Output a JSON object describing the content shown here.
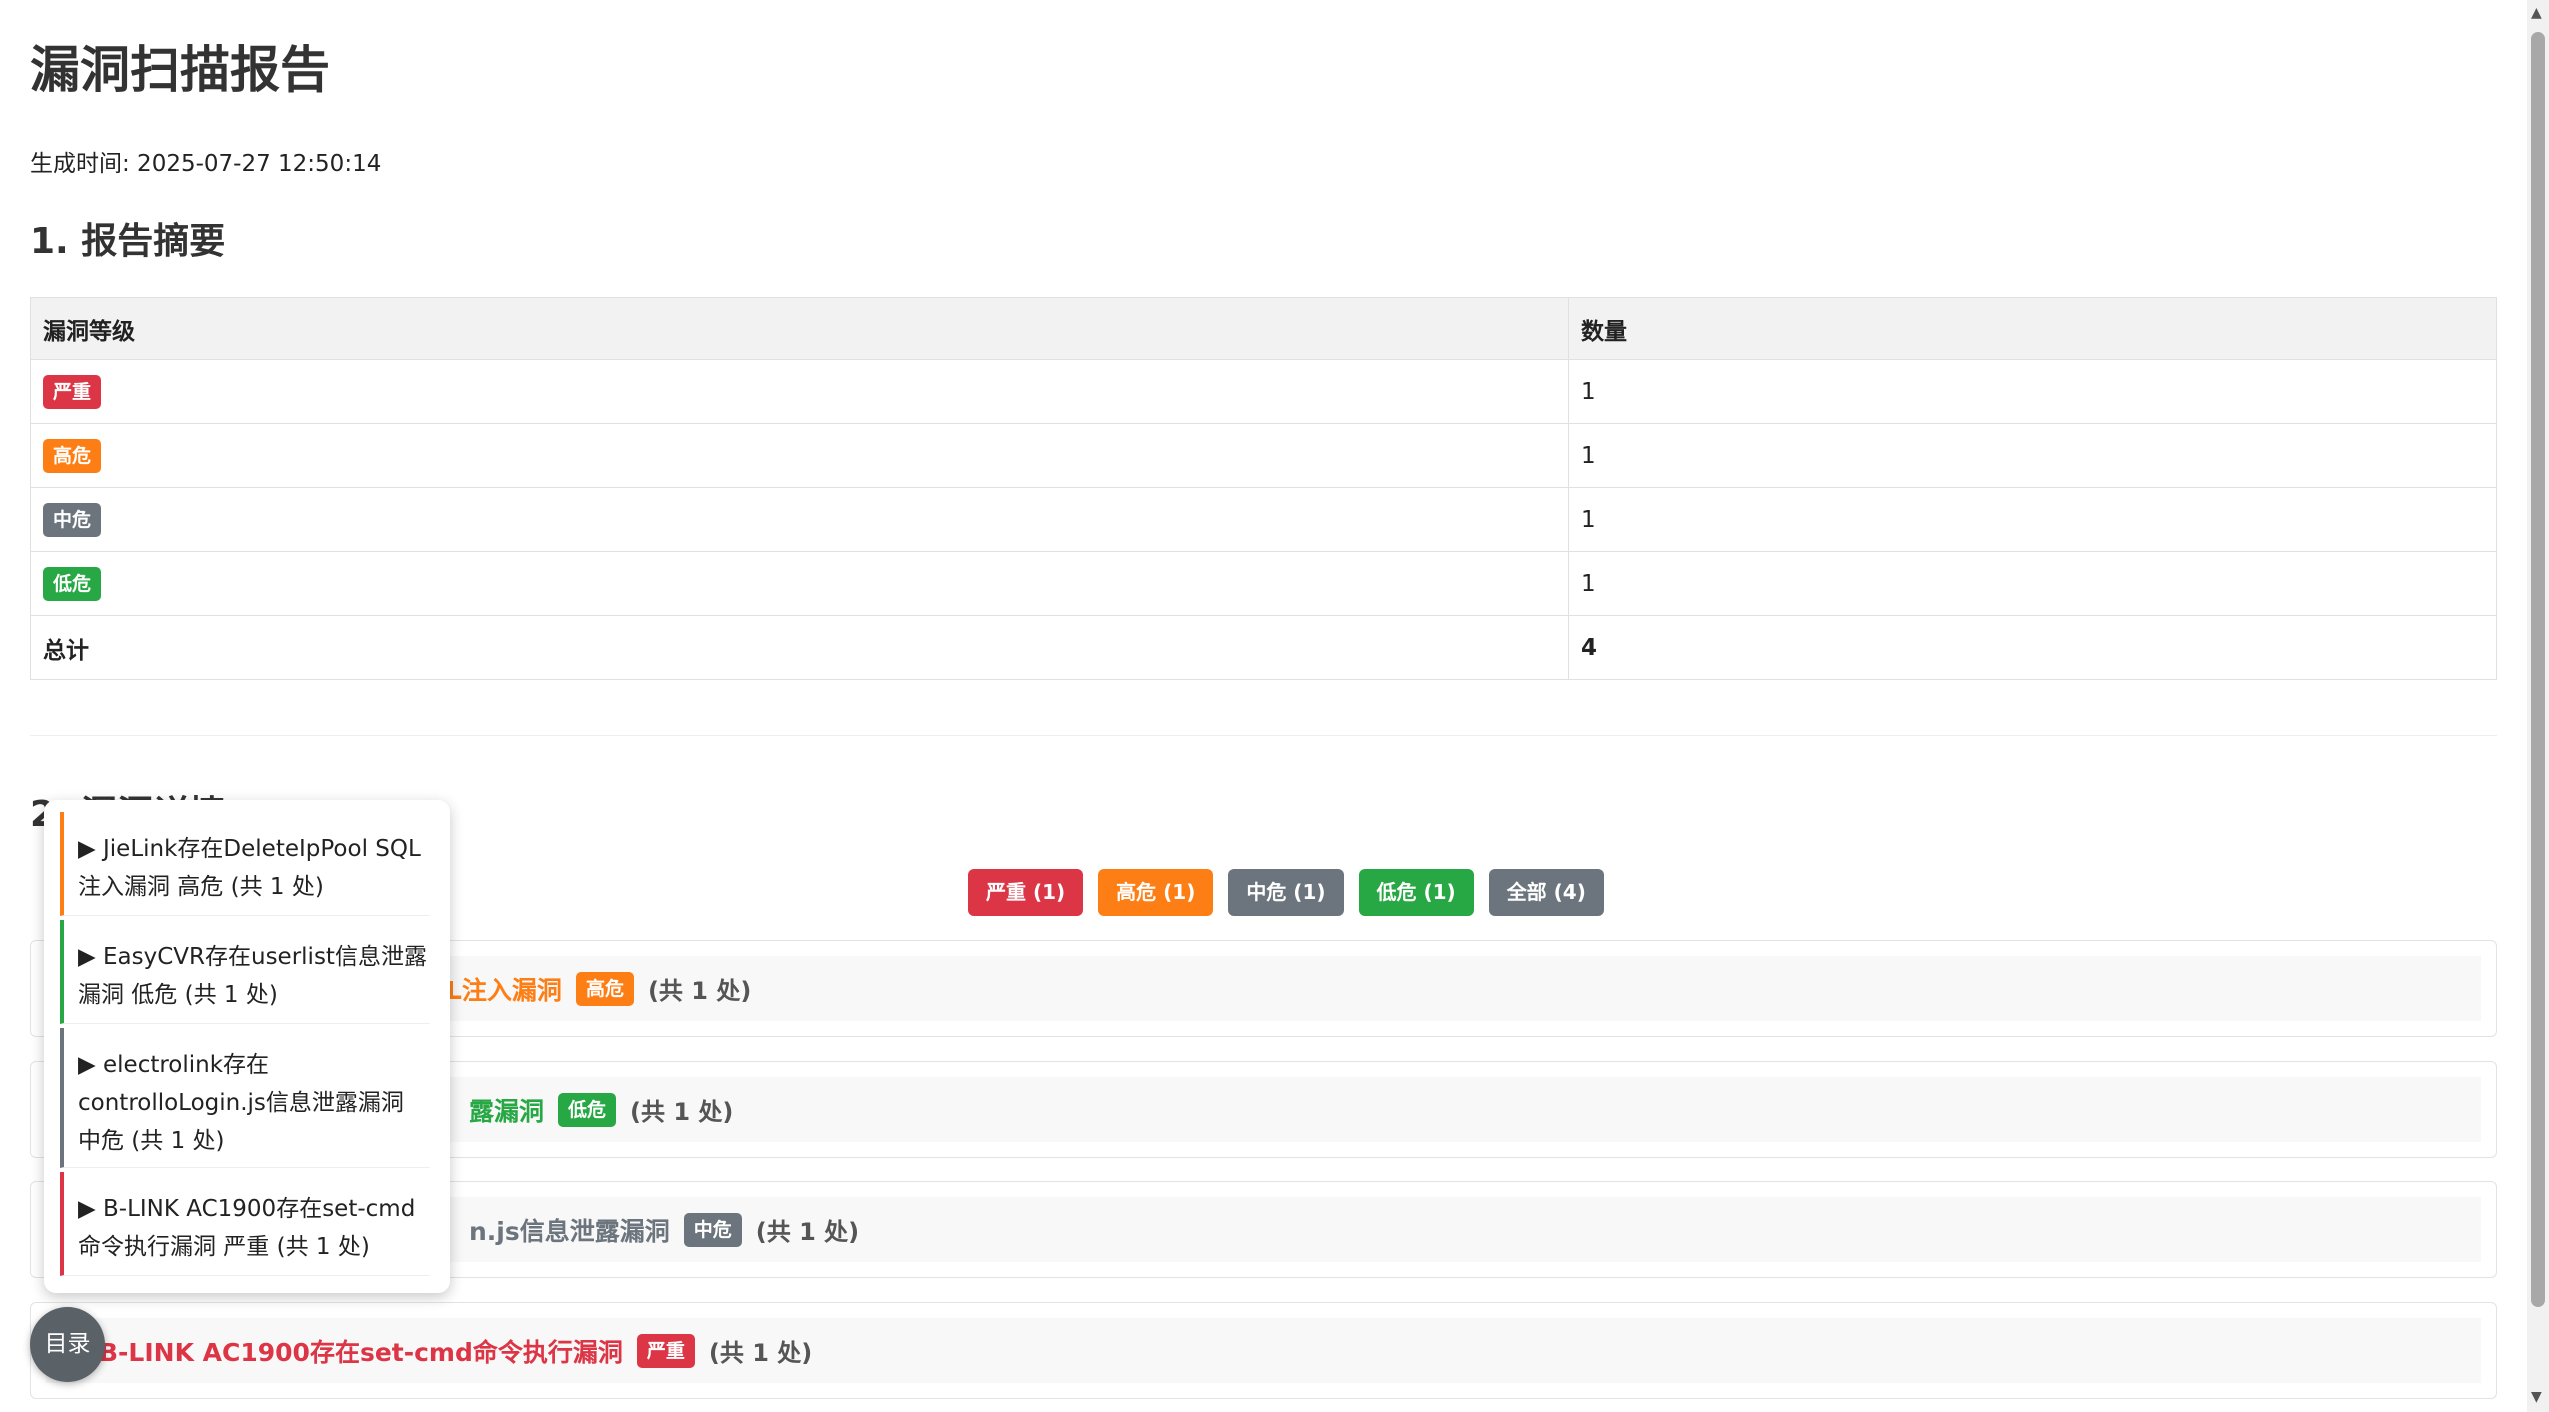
{
  "title": "漏洞扫描报告",
  "generated": "生成时间: 2025-07-27 12:50:14",
  "sections": {
    "summary_title": "1. 报告摘要",
    "details_title": "2. 漏洞详情"
  },
  "summary_table": {
    "headers": [
      "漏洞等级",
      "数量"
    ],
    "rows": [
      {
        "level": "严重",
        "count": "1"
      },
      {
        "level": "高危",
        "count": "1"
      },
      {
        "level": "中危",
        "count": "1"
      },
      {
        "level": "低危",
        "count": "1"
      }
    ],
    "total_label": "总计",
    "total": "4"
  },
  "filters": [
    {
      "label": "严重 (1)",
      "color": "#dc3545"
    },
    {
      "label": "高危 (1)",
      "color": "#fd7e14"
    },
    {
      "label": "中危 (1)",
      "color": "#6c757d"
    },
    {
      "label": "低危 (1)",
      "color": "#28a745"
    },
    {
      "label": "全部 (4)",
      "color": "#6c757d"
    }
  ],
  "vulns": [
    {
      "title_visible": "L注入漏洞",
      "badge": "高危",
      "count": "(共 1 处)"
    },
    {
      "title_visible": "露漏洞",
      "badge": "低危",
      "count": "(共 1 处)"
    },
    {
      "title_visible": "n.js信息泄露漏洞",
      "badge": "中危",
      "count": "(共 1 处)"
    },
    {
      "title_visible": "B-LINK AC1900存在set-cmd命令执行漏洞",
      "badge": "严重",
      "count": "(共 1 处)"
    }
  ],
  "toc": {
    "button": "目录",
    "items": [
      {
        "text": "▶ JieLink存在DeleteIpPool SQL注入漏洞 高危 (共 1 处)",
        "color": "#fd7e14"
      },
      {
        "text": "▶ EasyCVR存在userlist信息泄露漏洞 低危 (共 1 处)",
        "color": "#28a745"
      },
      {
        "text": "▶ electrolink存在controlloLogin.js信息泄露漏洞 中危 (共 1 处)",
        "color": "#6c757d"
      },
      {
        "text": "▶ B-LINK AC1900存在set-cmd命令执行漏洞 严重 (共 1 处)",
        "color": "#dc3545"
      }
    ]
  },
  "colors": {
    "critical": "#dc3545",
    "high": "#fd7e14",
    "medium": "#6c757d",
    "low": "#28a745"
  }
}
